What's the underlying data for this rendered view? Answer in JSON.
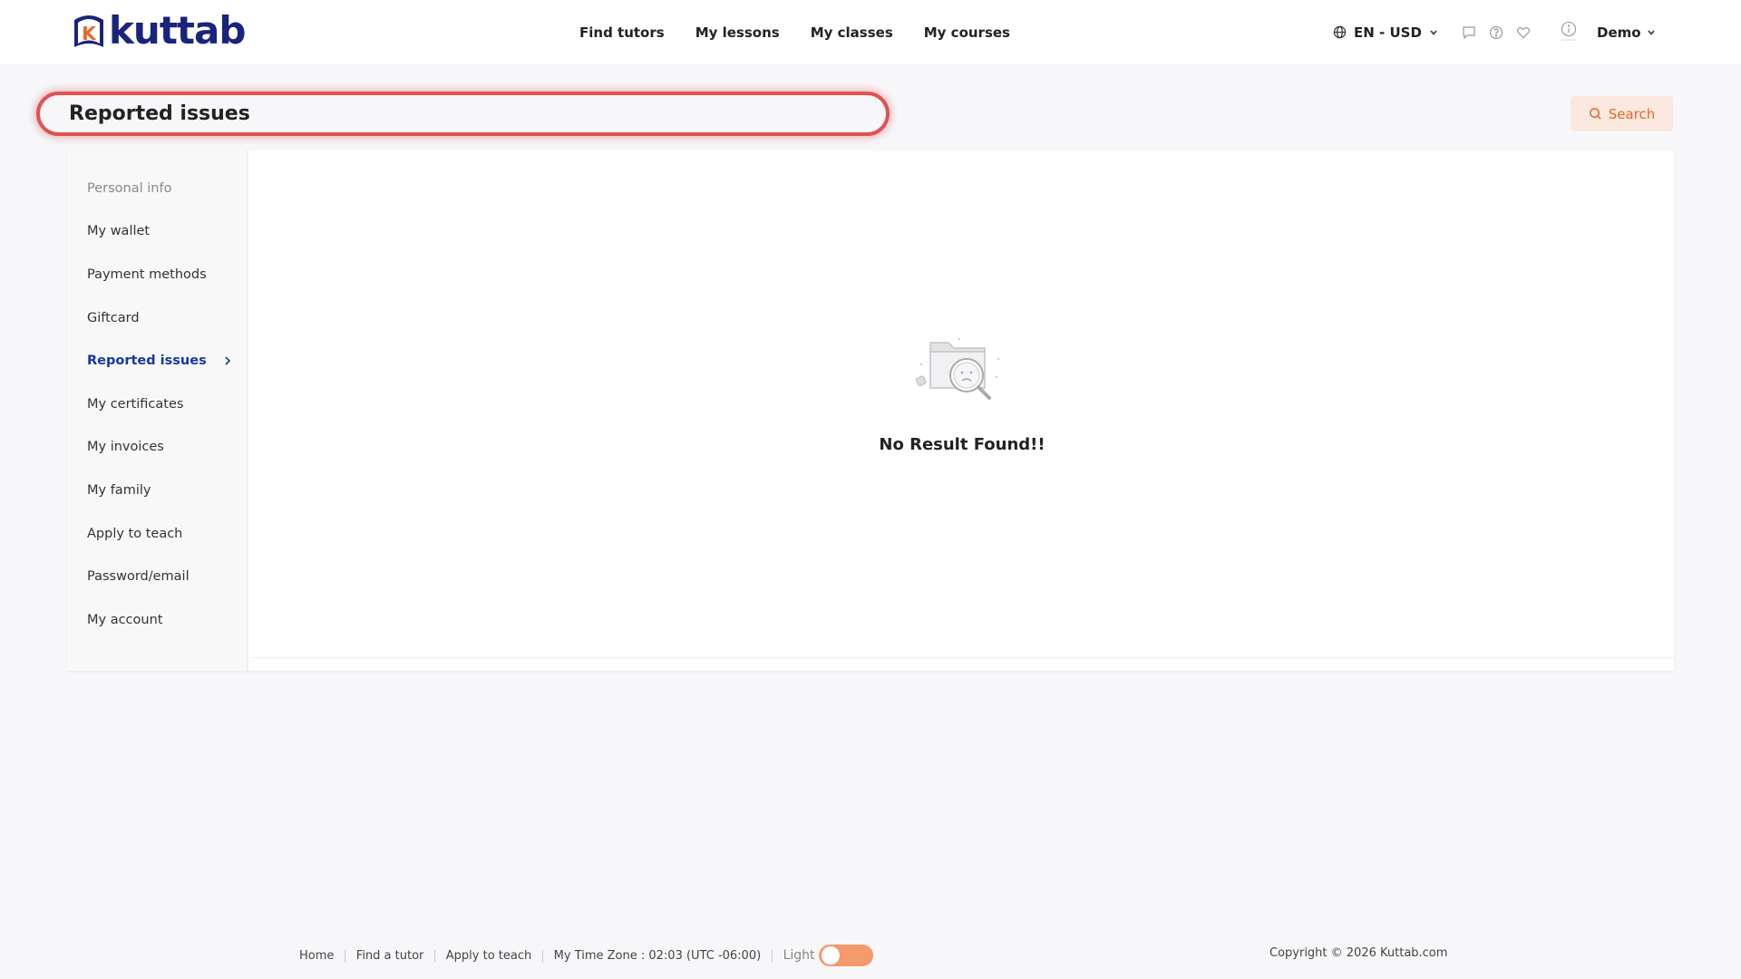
{
  "brand": {
    "name": "kuttab",
    "mark_letter": "K",
    "primary_color": "#1a237e",
    "accent_color": "#e8672a"
  },
  "nav": {
    "items": [
      {
        "label": "Find tutors"
      },
      {
        "label": "My lessons"
      },
      {
        "label": "My classes"
      },
      {
        "label": "My courses"
      }
    ]
  },
  "header": {
    "language": "EN - USD",
    "icons": [
      "chat-icon",
      "help-icon",
      "heart-icon",
      "info-icon"
    ],
    "user": "Demo"
  },
  "page": {
    "title": "Reported issues",
    "search_label": "Search"
  },
  "sidebar": {
    "items": [
      {
        "label": "Personal info"
      },
      {
        "label": "My wallet"
      },
      {
        "label": "Payment methods"
      },
      {
        "label": "Giftcard"
      },
      {
        "label": "Reported issues"
      },
      {
        "label": "My certificates"
      },
      {
        "label": "My invoices"
      },
      {
        "label": "My family"
      },
      {
        "label": "Apply to teach"
      },
      {
        "label": "Password/email"
      },
      {
        "label": "My account"
      }
    ]
  },
  "content": {
    "empty_message": "No Result Found!!"
  },
  "footer": {
    "links": [
      {
        "label": "Home"
      },
      {
        "label": "Find a tutor"
      },
      {
        "label": "Apply to teach"
      }
    ],
    "timezone": "My Time Zone : 02:03 (UTC -06:00)",
    "theme_label": "Light",
    "copyright": "Copyright © 2026 Kuttab.com"
  }
}
